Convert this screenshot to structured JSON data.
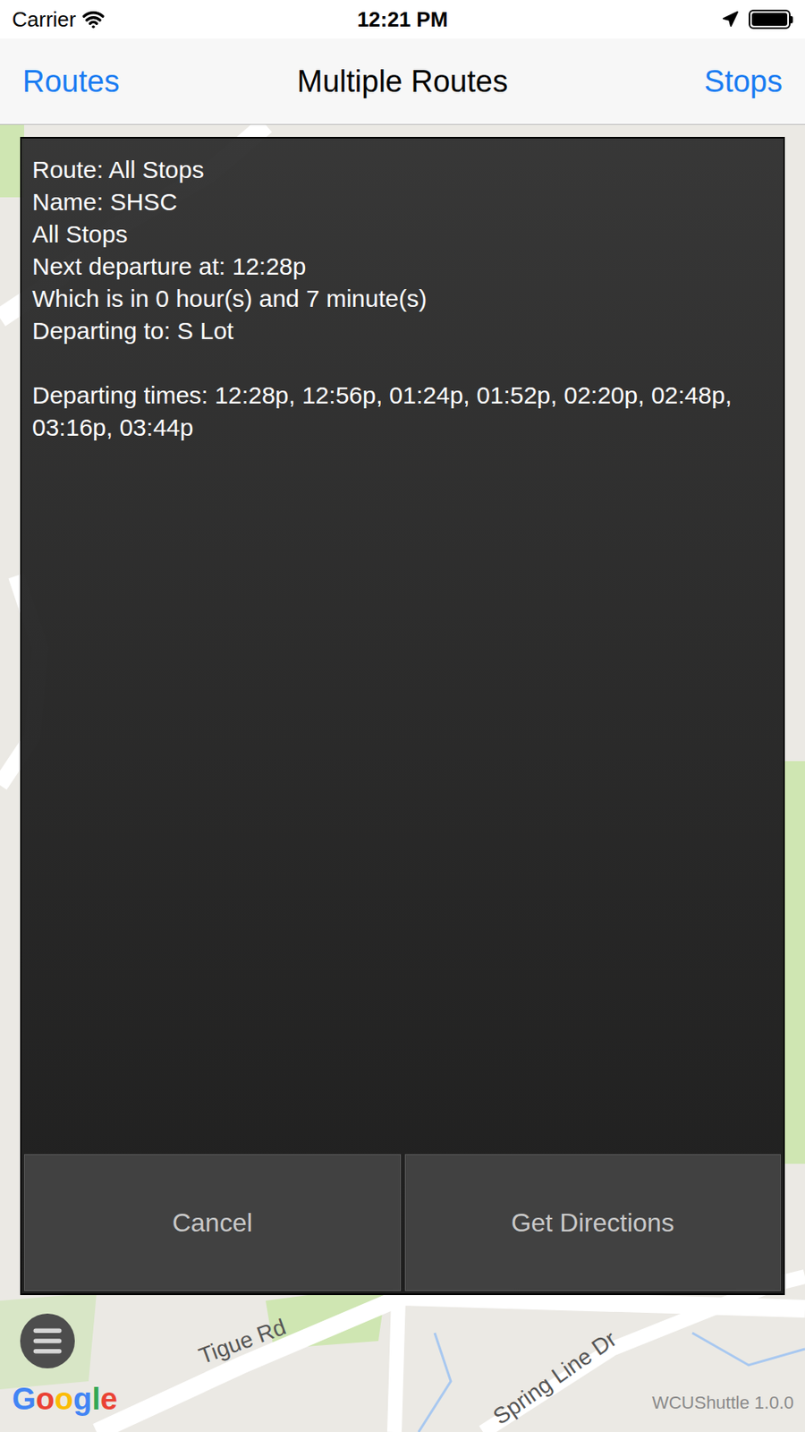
{
  "status_bar": {
    "carrier": "Carrier",
    "time": "12:21 PM",
    "battery_level": 1
  },
  "nav_bar": {
    "left": "Routes",
    "title": "Multiple Routes",
    "right": "Stops"
  },
  "info_panel": {
    "lines": [
      "Route: All Stops",
      "Name: SHSC",
      "All Stops",
      "Next departure at: 12:28p",
      "Which is in 0 hour(s) and 7 minute(s)",
      "Departing to: S Lot"
    ],
    "departing_times": "Departing times: 12:28p, 12:56p, 01:24p, 01:52p, 02:20p, 02:48p, 03:16p, 03:44p"
  },
  "buttons": [
    "Cancel",
    "Get Directions"
  ],
  "map": {
    "labels": [
      "Tigue Rd",
      "Spring Line Dr"
    ],
    "attribution": "Google",
    "version": "WCUShuttle 1.0.0"
  }
}
